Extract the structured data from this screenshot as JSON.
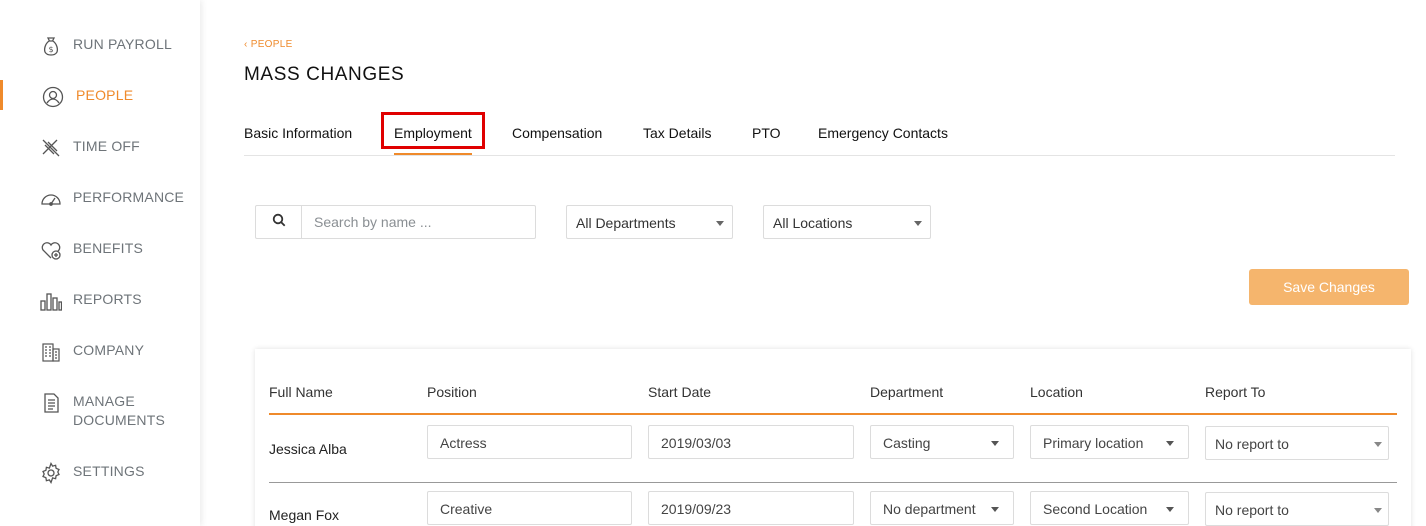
{
  "sidebar": {
    "items": [
      {
        "label": "RUN PAYROLL",
        "icon": "money-bag-icon"
      },
      {
        "label": "PEOPLE",
        "icon": "user-circle-icon",
        "active": true
      },
      {
        "label": "TIME OFF",
        "icon": "airplane-icon"
      },
      {
        "label": "PERFORMANCE",
        "icon": "gauge-icon"
      },
      {
        "label": "BENEFITS",
        "icon": "heart-plus-icon"
      },
      {
        "label": "REPORTS",
        "icon": "bar-chart-icon"
      },
      {
        "label": "COMPANY",
        "icon": "building-icon"
      },
      {
        "label": "MANAGE",
        "label2": "DOCUMENTS",
        "icon": "document-icon"
      },
      {
        "label": "SETTINGS",
        "icon": "gear-icon"
      }
    ]
  },
  "breadcrumb": {
    "label": "PEOPLE",
    "icon": "chevron-left-icon"
  },
  "page_title": "MASS CHANGES",
  "tabs": [
    {
      "label": "Basic Information"
    },
    {
      "label": "Employment",
      "active": true
    },
    {
      "label": "Compensation"
    },
    {
      "label": "Tax Details"
    },
    {
      "label": "PTO"
    },
    {
      "label": "Emergency Contacts"
    }
  ],
  "filters": {
    "search_placeholder": "Search by name ...",
    "department": "All Departments",
    "location": "All Locations"
  },
  "save_button": "Save Changes",
  "table": {
    "headers": [
      "Full Name",
      "Position",
      "Start Date",
      "Department",
      "Location",
      "Report To"
    ],
    "rows": [
      {
        "name": "Jessica Alba",
        "position": "Actress",
        "start_date": "2019/03/03",
        "department": "Casting",
        "location": "Primary location",
        "report_to": "No report to"
      },
      {
        "name": "Megan Fox",
        "position": "Creative",
        "start_date": "2019/09/23",
        "department": "No department",
        "location": "Second Location",
        "report_to": "No report to"
      }
    ]
  },
  "colors": {
    "accent": "#ef8a2b",
    "save_button": "#f5b56d",
    "highlight": "#e00000"
  }
}
